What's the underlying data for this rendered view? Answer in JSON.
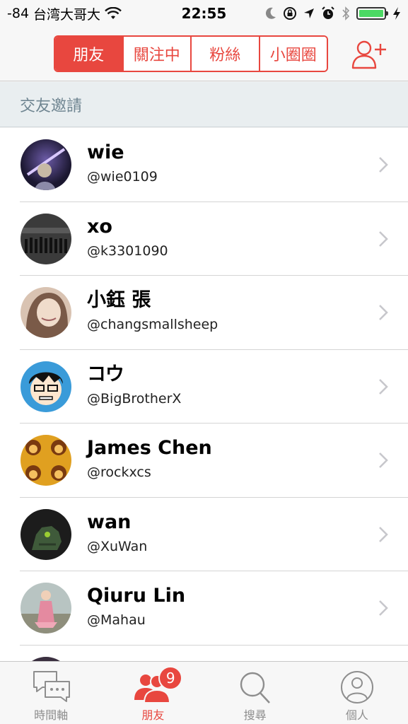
{
  "status_bar": {
    "signal": "-84",
    "carrier": "台湾大哥大",
    "time": "22:55",
    "battery_level": 1.0
  },
  "nav": {
    "segments": [
      {
        "label": "朋友",
        "active": true
      },
      {
        "label": "關注中",
        "active": false
      },
      {
        "label": "粉絲",
        "active": false
      },
      {
        "label": "小圈圈",
        "active": false
      }
    ],
    "add_friend_icon": "add-user-icon"
  },
  "section_header": "交友邀請",
  "friends": [
    {
      "name": "wie",
      "handle": "@wie0109"
    },
    {
      "name": "xo",
      "handle": "@k3301090"
    },
    {
      "name": "小鈺 張",
      "handle": "@changsmallsheep"
    },
    {
      "name": "コウ",
      "handle": "@BigBrotherX"
    },
    {
      "name": "James Chen",
      "handle": "@rockxcs"
    },
    {
      "name": "wan",
      "handle": "@XuWan"
    },
    {
      "name": "Qiuru Lin",
      "handle": "@Mahau"
    }
  ],
  "tabs": [
    {
      "label": "時間軸",
      "icon": "chat-bubbles-icon",
      "active": false
    },
    {
      "label": "朋友",
      "icon": "friends-icon",
      "active": true,
      "badge": "9"
    },
    {
      "label": "搜尋",
      "icon": "search-icon",
      "active": false
    },
    {
      "label": "個人",
      "icon": "profile-icon",
      "active": false
    }
  ],
  "colors": {
    "accent": "#e8473f",
    "section_text": "#6f8591",
    "battery": "#4cd964"
  }
}
